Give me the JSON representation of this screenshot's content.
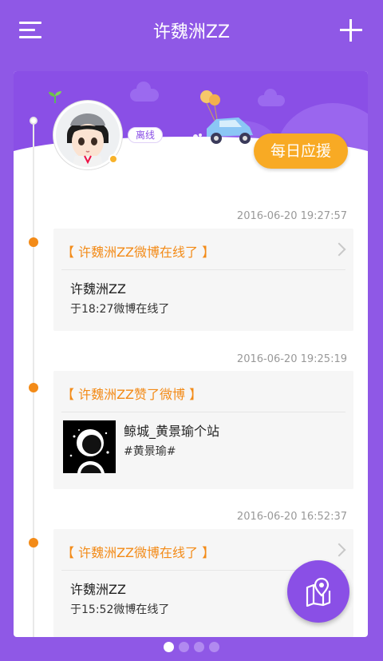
{
  "header": {
    "title": "许魏洲ZZ",
    "menu_icon": "menu-icon",
    "add_icon": "plus-icon"
  },
  "profile": {
    "status": "离线",
    "support_button": "每日应援"
  },
  "feed": [
    {
      "timestamp": "2016-06-20 19:27:57",
      "headline": "【 许魏洲ZZ微博在线了 】",
      "name": "许魏洲ZZ",
      "detail": "于18:27微博在线了"
    },
    {
      "timestamp": "2016-06-20 19:25:19",
      "headline": "【 许魏洲ZZ赞了微博 】",
      "share_title": "鲸城_黄景瑜个站",
      "share_tag": "#黄景瑜#"
    },
    {
      "timestamp": "2016-06-20 16:52:37",
      "headline": "【 许魏洲ZZ微博在线了 】",
      "name": "许魏洲ZZ",
      "detail": "于15:52微博在线了"
    }
  ],
  "pager": {
    "count": 4,
    "active_index": 0
  },
  "colors": {
    "primary": "#8f58e6",
    "accent_orange": "#f38b18",
    "support_button": "#f8aa24"
  },
  "fab_icon": "map-pin-icon"
}
